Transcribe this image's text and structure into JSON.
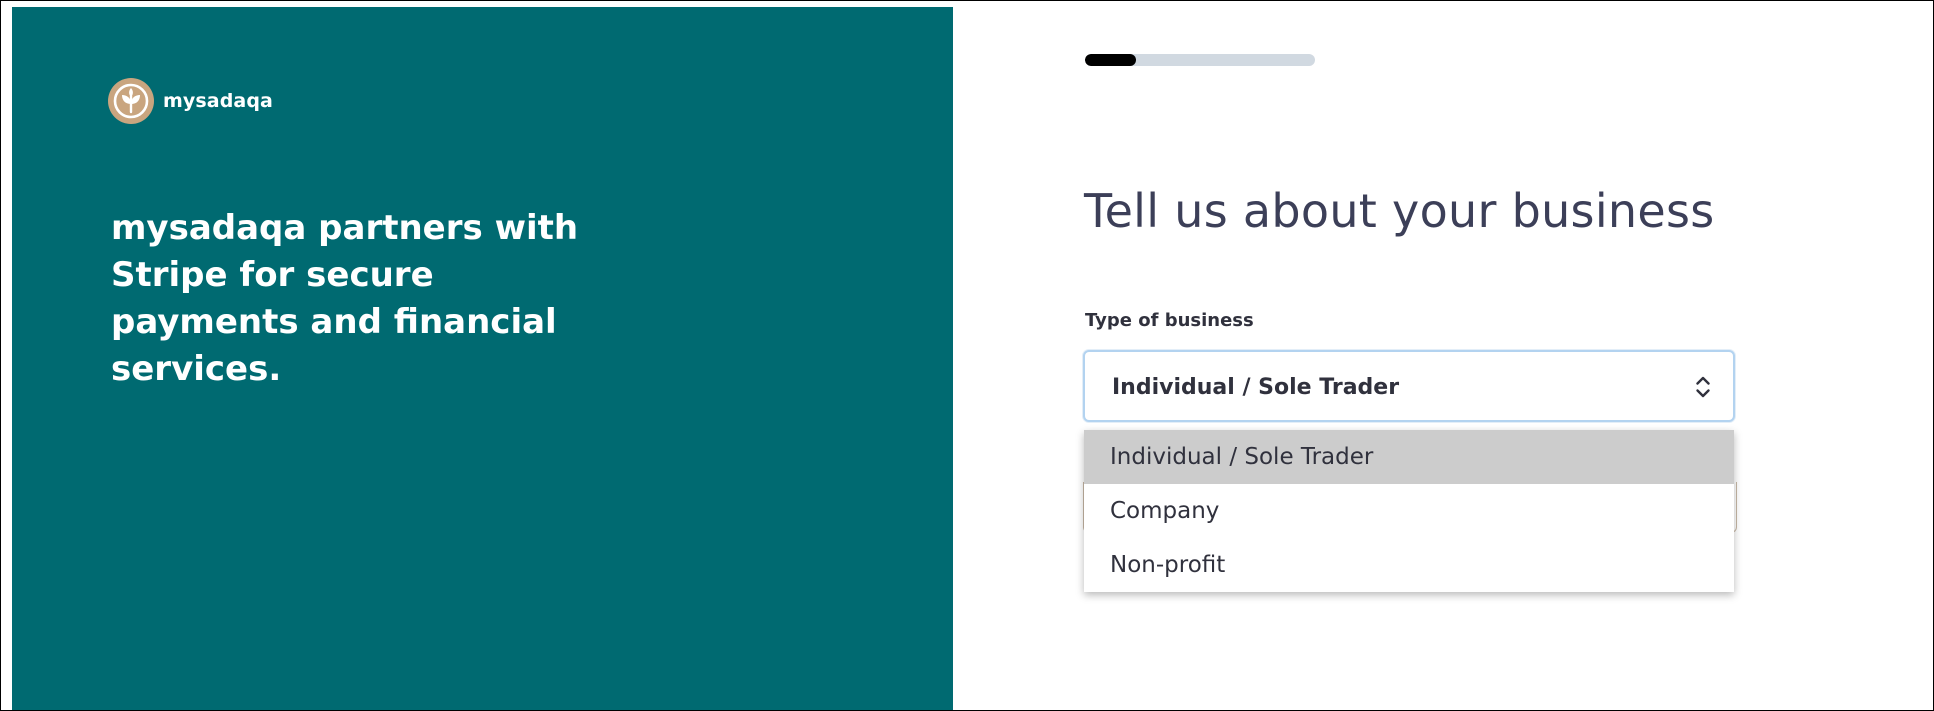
{
  "brand": {
    "name": "mysadaqa",
    "logo_icon": "wheat-leaf-icon",
    "logo_color": "#c9a57f"
  },
  "left_panel": {
    "tagline": "mysadaqa partners with Stripe for secure payments and financial services.",
    "background": "#006a71"
  },
  "progress": {
    "fraction": 0.22
  },
  "form": {
    "title": "Tell us about your business",
    "business_type": {
      "label": "Type of business",
      "selected_value": "Individual / Sole Trader",
      "icon": "chevron-up-down-icon",
      "options": [
        {
          "label": "Individual / Sole Trader",
          "highlighted": true
        },
        {
          "label": "Company",
          "highlighted": false
        },
        {
          "label": "Non-profit",
          "highlighted": false
        }
      ]
    }
  }
}
